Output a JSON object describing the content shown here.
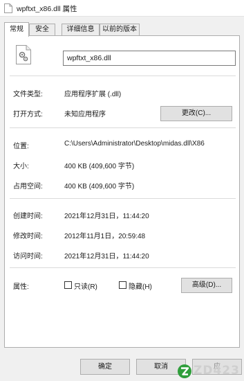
{
  "window": {
    "title": "wpftxt_x86.dll 属性"
  },
  "tabs": [
    {
      "label": "常规"
    },
    {
      "label": "安全"
    },
    {
      "label": "详细信息"
    },
    {
      "label": "以前的版本"
    }
  ],
  "general": {
    "file_icon": "dll-file-gear-icon",
    "file_name": "wpftxt_x86.dll",
    "type_label": "文件类型:",
    "type_value": "应用程序扩展 (.dll)",
    "opens_with_label": "打开方式:",
    "opens_with_value": "未知应用程序",
    "change_button": "更改(C)...",
    "location_label": "位置:",
    "location_value": "C:\\Users\\Administrator\\Desktop\\midas.dll\\X86",
    "size_label": "大小:",
    "size_value": "400 KB (409,600 字节)",
    "size_on_disk_label": "占用空间:",
    "size_on_disk_value": "400 KB (409,600 字节)",
    "created_label": "创建时间:",
    "created_value": "2021年12月31日，11:44:20",
    "modified_label": "修改时间:",
    "modified_value": "2012年11月1日，20:59:48",
    "accessed_label": "访问时间:",
    "accessed_value": "2021年12月31日，11:44:20",
    "attributes_label": "属性:",
    "readonly_label": "只读(R)",
    "readonly_checked": false,
    "hidden_label": "隐藏(H)",
    "hidden_checked": false,
    "advanced_button": "高级(D)..."
  },
  "footer": {
    "ok_button": "确定",
    "cancel_button": "取消",
    "apply_button": "应"
  },
  "watermark": {
    "text": "ZD423",
    "icon": "zd-logo-icon"
  }
}
